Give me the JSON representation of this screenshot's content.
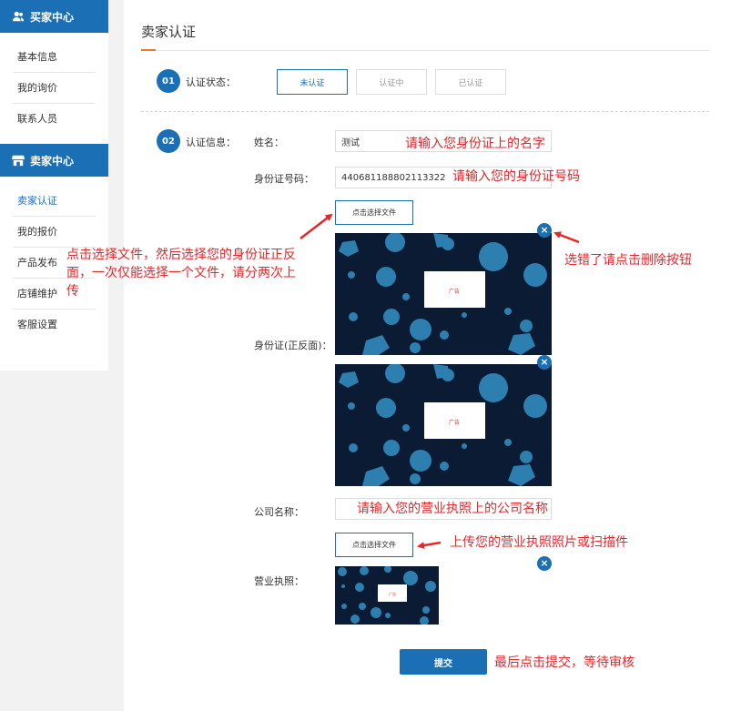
{
  "sidebar": {
    "buyer": {
      "title": "买家中心",
      "items": [
        "基本信息",
        "我的询价",
        "联系人员"
      ]
    },
    "seller": {
      "title": "卖家中心",
      "items": [
        "卖家认证",
        "我的报价",
        "产品发布",
        "店铺维护",
        "客服设置"
      ]
    }
  },
  "main": {
    "title": "卖家认证",
    "step1": {
      "number": "01",
      "label": "认证状态：",
      "statuses": [
        "未认证",
        "认证中",
        "已认证"
      ]
    },
    "step2": {
      "number": "02",
      "label": "认证信息："
    },
    "fields": {
      "name_label": "姓名：",
      "name_value": "测试",
      "id_label": "身份证号码：",
      "id_value": "440681188802113322",
      "id_upload_label": "身份证(正反面)：",
      "company_label": "公司名称：",
      "company_value": "",
      "license_label": "营业执照："
    },
    "file_button": "点击选择文件",
    "close_symbol": "×",
    "img_text": "广告",
    "submit": "提交"
  },
  "annotations": {
    "name_hint": "请输入您身份证上的名字",
    "id_hint": "请输入您的身份证号码",
    "file_hint_1": "点击选择文件，然后选择您的身份证正反",
    "file_hint_2": "面，一次仅能选择一个文件，请分两次上",
    "file_hint_3": "传",
    "delete_hint": "选错了请点击删除按钮",
    "company_hint": "请输入您的营业执照上的公司名称",
    "license_hint": "上传您的营业执照照片或扫描件",
    "submit_hint": "最后点击提交，等待审核"
  },
  "colors": {
    "primary": "#1a6fb5",
    "annotation": "#e8262a",
    "image_bg": "#0a1b33",
    "image_dots": "#2c7fae"
  }
}
